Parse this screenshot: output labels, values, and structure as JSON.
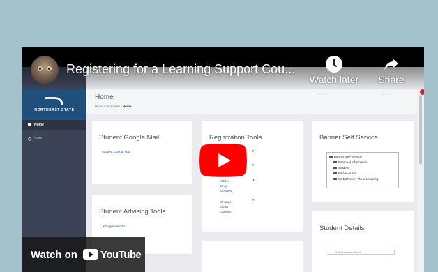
{
  "video": {
    "title": "Registering for a Learning Support Cou...",
    "watch_later_label": "Watch later",
    "share_label": "Share",
    "watch_on_label": "Watch on",
    "youtube_label": "YouTube"
  },
  "portal": {
    "logo_text": "NORTHEAST STATE",
    "nav": [
      {
        "label": "Home"
      },
      {
        "label": "Sites"
      }
    ],
    "page_title": "Home",
    "breadcrumb": {
      "root": "Home Community",
      "current": "Home"
    },
    "top_right": {
      "my_store": "My Store",
      "sign_out": "Sign Out"
    },
    "cards": {
      "google_mail": {
        "title": "Student Google Mail",
        "link": "Student Google Mail"
      },
      "registration": {
        "title": "Registration Tools",
        "links": [
          "Add or Drop Classes",
          "Change Class Options"
        ]
      },
      "banner": {
        "title": "Banner Self Service",
        "tree": [
          "Banner Self-Service",
          "Personal Information",
          "Student",
          "Financial Aid",
          "WebCT.com, The e-Learning"
        ]
      },
      "advising": {
        "title": "Student Advising Tools",
        "link": "Degree Works"
      },
      "details": {
        "title": "Student Details",
        "select_placeholder": "Select Another Term"
      }
    }
  },
  "colors": {
    "page_background": "#a3c2cb",
    "youtube_red": "#ff0000",
    "portal_nav": "#3d4357",
    "portal_logo_bg": "#1f4f7a"
  }
}
